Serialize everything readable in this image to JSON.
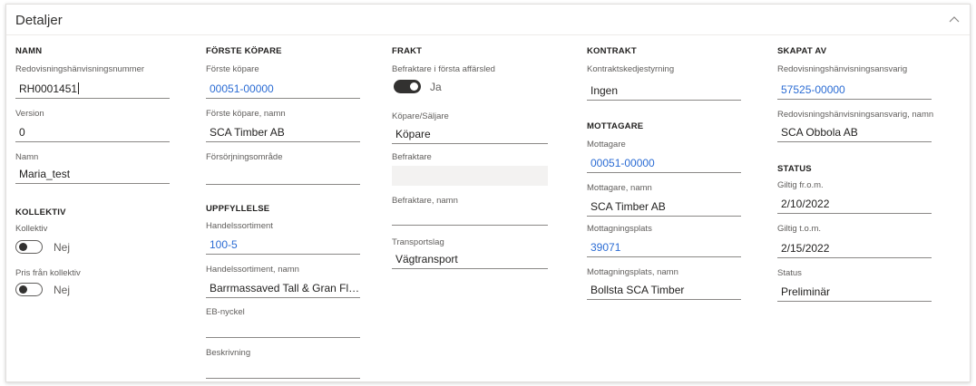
{
  "panel": {
    "title": "Detaljer"
  },
  "col1": {
    "namn_header": "NAMN",
    "redov_label": "Redovisningshänvisningsnummer",
    "redov_value": "RH0001451",
    "version_label": "Version",
    "version_value": "0",
    "namn_label": "Namn",
    "namn_value": "Maria_test",
    "kollektiv_header": "KOLLEKTIV",
    "kollektiv_label": "Kollektiv",
    "kollektiv_toggle": "Nej",
    "pris_label": "Pris från kollektiv",
    "pris_toggle": "Nej"
  },
  "col2": {
    "header": "FÖRSTE KÖPARE",
    "kopare_label": "Förste köpare",
    "kopare_value": "00051-00000",
    "kopare_namn_label": "Förste köpare, namn",
    "kopare_namn_value": "SCA Timber AB",
    "forsorj_label": "Försörjningsområde",
    "forsorj_value": "",
    "uppf_header": "UPPFYLLELSE",
    "hs_label": "Handelssortiment",
    "hs_value": "100-5",
    "hs_namn_label": "Handelssortiment, namn",
    "hs_namn_value": "Barrmassaved Tall & Gran Flertr...",
    "eb_label": "EB-nyckel",
    "eb_value": "",
    "beskr_label": "Beskrivning",
    "beskr_value": ""
  },
  "col3": {
    "header": "FRAKT",
    "bef_forsta_label": "Befraktare i första affärsled",
    "bef_forsta_toggle": "Ja",
    "kopsalj_label": "Köpare/Säljare",
    "kopsalj_value": "Köpare",
    "befraktare_label": "Befraktare",
    "befraktare_value": "",
    "bef_namn_label": "Befraktare, namn",
    "bef_namn_value": "",
    "transport_label": "Transportslag",
    "transport_value": "Vägtransport"
  },
  "col4": {
    "header": "KONTRAKT",
    "kedje_label": "Kontraktskedjestyrning",
    "kedje_value": "Ingen",
    "mott_header": "MOTTAGARE",
    "mott_label": "Mottagare",
    "mott_value": "00051-00000",
    "mott_namn_label": "Mottagare, namn",
    "mott_namn_value": "SCA Timber AB",
    "plats_label": "Mottagningsplats",
    "plats_value": "39071",
    "plats_namn_label": "Mottagningsplats, namn",
    "plats_namn_value": "Bollsta SCA Timber"
  },
  "col5": {
    "header": "SKAPAT AV",
    "ansv_label": "Redovisningshänvisningsansvarig",
    "ansv_value": "57525-00000",
    "ansv_namn_label": "Redovisningshänvisningsansvarig, namn",
    "ansv_namn_value": "SCA Obbola AB",
    "status_header": "STATUS",
    "from_label": "Giltig fr.o.m.",
    "from_value": "2/10/2022",
    "tom_label": "Giltig t.o.m.",
    "tom_value": "2/15/2022",
    "status_label": "Status",
    "status_value": "Preliminär"
  }
}
